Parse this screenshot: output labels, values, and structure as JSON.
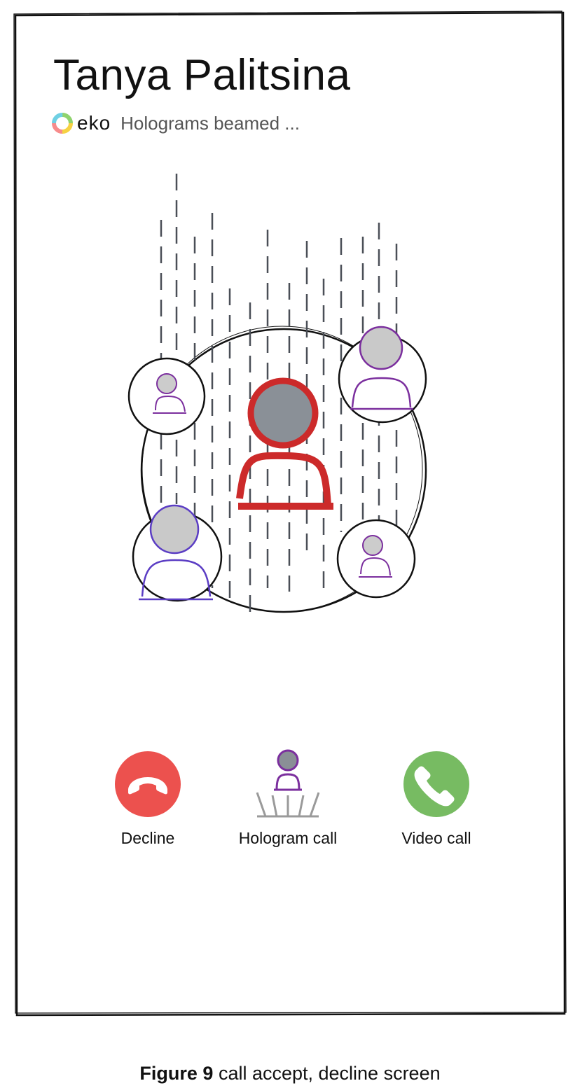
{
  "caller": {
    "name": "Tanya Palitsina"
  },
  "app": {
    "brand": "eko",
    "status": "Holograms beamed ..."
  },
  "actions": {
    "decline": {
      "label": "Decline",
      "color": "#ec514e",
      "icon": "phone-hangup-icon"
    },
    "hologram": {
      "label": "Hologram call",
      "color": "#7b2f9e",
      "icon": "hologram-person-icon"
    },
    "video": {
      "label": "Video call",
      "color": "#77bb62",
      "icon": "phone-icon"
    }
  },
  "caption": {
    "figure": "Figure 9",
    "text": "call accept, decline screen"
  },
  "colors": {
    "primary_hologram": "#cc2a2a",
    "participant_purple": "#7b2f9e",
    "participant_violet": "#5b3dc4",
    "beam_dash": "#4a4f57"
  }
}
